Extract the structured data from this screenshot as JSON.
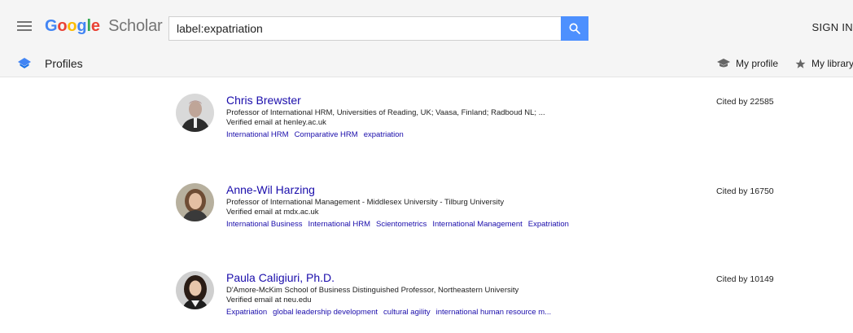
{
  "header": {
    "logo_letters": [
      "G",
      "o",
      "o",
      "g",
      "l",
      "e"
    ],
    "product_name": "Scholar",
    "search": {
      "value": "label:expatriation"
    },
    "sign_in_label": "SIGN IN"
  },
  "subheader": {
    "title": "Profiles",
    "my_profile_label": "My profile",
    "my_library_label": "My library"
  },
  "profiles": [
    {
      "name": "Chris Brewster",
      "affiliation": "Professor of International HRM, Universities of Reading, UK; Vaasa, Finland; Radboud NL; ...",
      "email": "Verified email at henley.ac.uk",
      "cited_by": "Cited by 22585",
      "interests": [
        "International HRM",
        "Comparative HRM",
        "expatriation"
      ]
    },
    {
      "name": "Anne-Wil Harzing",
      "affiliation": "Professor of International Management - Middlesex University - Tilburg University",
      "email": "Verified email at mdx.ac.uk",
      "cited_by": "Cited by 16750",
      "interests": [
        "International Business",
        "International HRM",
        "Scientometrics",
        "International Management",
        "Expatriation"
      ]
    },
    {
      "name": "Paula Caligiuri, Ph.D.",
      "affiliation": "D'Amore-McKim School of Business Distinguished Professor, Northeastern University",
      "email": "Verified email at neu.edu",
      "cited_by": "Cited by 10149",
      "interests": [
        "Expatriation",
        "global leadership development",
        "cultural agility",
        "international human resource m..."
      ]
    }
  ],
  "colors": {
    "link": "#1a0dab",
    "search_button": "#4d90fe",
    "header_bg": "#f5f5f5"
  },
  "icons": [
    "menu-icon",
    "search-icon",
    "profiles-icon",
    "graduation-cap-icon",
    "star-icon"
  ]
}
